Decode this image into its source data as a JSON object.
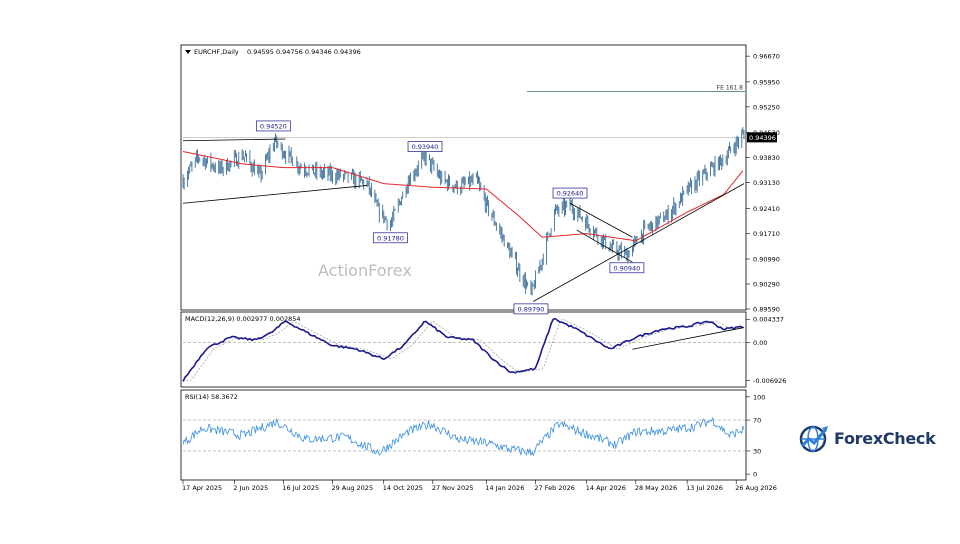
{
  "watermark": "ActionForex",
  "brand": {
    "name": "ForexCheck",
    "icon": "globe-chart-icon",
    "colors": [
      "#1f3a68",
      "#2f7fd8"
    ]
  },
  "chart_data": [
    {
      "type": "candlestick",
      "title": "EURCHF,Daily",
      "ohlc_text": "0.94595 0.94756 0.94346 0.94396",
      "ylim": [
        0.8959,
        0.9687
      ],
      "y_ticks": [
        "0.96670",
        "0.95950",
        "0.95250",
        "0.94530",
        "0.93830",
        "0.93130",
        "0.92410",
        "0.91710",
        "0.90990",
        "0.90290",
        "0.89590"
      ],
      "y_tick_values": [
        0.9667,
        0.9595,
        0.9525,
        0.9453,
        0.9383,
        0.9313,
        0.9241,
        0.9171,
        0.9099,
        0.9029,
        0.8959
      ],
      "current_price": "0.94396",
      "current_price_value": 0.94396,
      "moving_average_color": "#e8262a",
      "price_color": "#3b6e99",
      "level_line": {
        "label": "FE 161.8",
        "value": 0.9568
      },
      "labeled_points": [
        {
          "label": "0.94520",
          "date": "2025-07-07",
          "value": 0.9452
        },
        {
          "label": "0.93940",
          "date": "2025-11-20",
          "value": 0.9394
        },
        {
          "label": "0.91780",
          "date": "2025-10-20",
          "value": 0.9178
        },
        {
          "label": "0.92640",
          "date": "2026-03-30",
          "value": 0.9264
        },
        {
          "label": "0.90940",
          "date": "2026-05-20",
          "value": 0.9094
        },
        {
          "label": "0.89790",
          "date": "2026-02-23",
          "value": 0.8979
        }
      ],
      "path_anchors": [
        [
          "2025-04-17",
          0.932
        ],
        [
          "2025-05-01",
          0.9385
        ],
        [
          "2025-05-20",
          0.935
        ],
        [
          "2025-06-10",
          0.939
        ],
        [
          "2025-06-25",
          0.933
        ],
        [
          "2025-07-08",
          0.943
        ],
        [
          "2025-07-16",
          0.94
        ],
        [
          "2025-07-30",
          0.936
        ],
        [
          "2025-08-15",
          0.934
        ],
        [
          "2025-09-10",
          0.933
        ],
        [
          "2025-09-29",
          0.931
        ],
        [
          "2025-10-08",
          0.924
        ],
        [
          "2025-10-20",
          0.9195
        ],
        [
          "2025-11-05",
          0.932
        ],
        [
          "2025-11-20",
          0.9385
        ],
        [
          "2025-12-05",
          0.932
        ],
        [
          "2025-12-20",
          0.93
        ],
        [
          "2026-01-05",
          0.932
        ],
        [
          "2026-01-14",
          0.925
        ],
        [
          "2026-01-30",
          0.915
        ],
        [
          "2026-02-10",
          0.908
        ],
        [
          "2026-02-23",
          0.9
        ],
        [
          "2026-03-05",
          0.91
        ],
        [
          "2026-03-16",
          0.923
        ],
        [
          "2026-03-30",
          0.925
        ],
        [
          "2026-04-14",
          0.92
        ],
        [
          "2026-05-05",
          0.913
        ],
        [
          "2026-05-20",
          0.911
        ],
        [
          "2026-06-05",
          0.918
        ],
        [
          "2026-06-25",
          0.922
        ],
        [
          "2026-07-13",
          0.929
        ],
        [
          "2026-07-30",
          0.934
        ],
        [
          "2026-08-15",
          0.938
        ],
        [
          "2026-09-02",
          0.945
        ]
      ],
      "ma_anchors": [
        [
          "2025-04-17",
          0.94
        ],
        [
          "2025-06-10",
          0.9365
        ],
        [
          "2025-07-16",
          0.9355
        ],
        [
          "2025-08-29",
          0.9355
        ],
        [
          "2025-10-14",
          0.931
        ],
        [
          "2025-11-27",
          0.93
        ],
        [
          "2026-01-14",
          0.9295
        ],
        [
          "2026-02-12",
          0.922
        ],
        [
          "2026-03-05",
          0.916
        ],
        [
          "2026-04-14",
          0.917
        ],
        [
          "2026-05-28",
          0.915
        ],
        [
          "2026-07-13",
          0.923
        ],
        [
          "2026-08-15",
          0.928
        ],
        [
          "2026-09-02",
          0.935
        ]
      ],
      "x_ticks": [
        "17 Apr 2025",
        "2 Jun 2025",
        "16 Jul 2025",
        "29 Aug 2025",
        "14 Oct 2025",
        "27 Nov 2025",
        "14 Jan 2026",
        "27 Feb 2026",
        "14 Apr 2026",
        "28 May 2026",
        "13 Jul 2026",
        "26 Aug 2026"
      ],
      "x_tick_dates": [
        "2025-04-17",
        "2025-06-02",
        "2025-07-16",
        "2025-08-29",
        "2025-10-14",
        "2025-11-27",
        "2026-01-14",
        "2026-02-27",
        "2026-04-14",
        "2026-05-28",
        "2026-07-13",
        "2026-08-26"
      ],
      "x_range": [
        "2025-04-17",
        "2026-09-02"
      ],
      "trendlines": [
        {
          "from": [
            "2025-04-17",
            0.9255
          ],
          "to": [
            "2025-09-29",
            0.9305
          ]
        },
        {
          "from": [
            "2025-04-17",
            0.943
          ],
          "to": [
            "2025-07-18",
            0.9435
          ]
        },
        {
          "from": [
            "2026-02-25",
            0.898
          ],
          "to": [
            "2026-09-02",
            0.931
          ]
        },
        {
          "from": [
            "2026-03-30",
            0.9255
          ],
          "to": [
            "2026-05-25",
            0.916
          ]
        },
        {
          "from": [
            "2026-04-05",
            0.918
          ],
          "to": [
            "2026-05-25",
            0.909
          ]
        }
      ]
    },
    {
      "type": "line",
      "title": "MACD(12,26,9) 0.002977 0.002854",
      "y_ticks": [
        "0.004337",
        "0.00",
        "-0.006926"
      ],
      "y_tick_values": [
        0.004337,
        0.0,
        -0.006926
      ],
      "ylim": [
        -0.0078,
        0.0053
      ],
      "series": [
        {
          "color": "#1a1a8f",
          "anchors": [
            [
              "2025-04-17",
              -0.007
            ],
            [
              "2025-05-08",
              -0.001
            ],
            [
              "2025-05-30",
              0.001
            ],
            [
              "2025-06-20",
              0.0005
            ],
            [
              "2025-07-05",
              0.0018
            ],
            [
              "2025-07-18",
              0.004
            ],
            [
              "2025-08-05",
              0.002
            ],
            [
              "2025-08-29",
              -0.0005
            ],
            [
              "2025-09-20",
              -0.0012
            ],
            [
              "2025-10-14",
              -0.003
            ],
            [
              "2025-11-01",
              -0.0005
            ],
            [
              "2025-11-20",
              0.004
            ],
            [
              "2025-12-10",
              0.001
            ],
            [
              "2026-01-02",
              0.0005
            ],
            [
              "2026-01-20",
              -0.003
            ],
            [
              "2026-02-05",
              -0.0055
            ],
            [
              "2026-02-27",
              -0.0048
            ],
            [
              "2026-03-15",
              0.0045
            ],
            [
              "2026-04-05",
              0.0025
            ],
            [
              "2026-05-05",
              -0.0012
            ],
            [
              "2026-05-28",
              0.001
            ],
            [
              "2026-06-20",
              0.0025
            ],
            [
              "2026-07-13",
              0.003
            ],
            [
              "2026-08-01",
              0.004
            ],
            [
              "2026-08-15",
              0.0025
            ],
            [
              "2026-09-02",
              0.003
            ]
          ]
        }
      ]
    },
    {
      "type": "line",
      "title": "RSI(14) 58.3672",
      "y_ticks": [
        "100",
        "70",
        "30",
        "0"
      ],
      "y_tick_values": [
        100,
        70,
        30,
        0
      ],
      "ylim": [
        -5,
        105
      ],
      "series": [
        {
          "color": "#3a8fe0",
          "anchors": [
            [
              "2025-04-17",
              40
            ],
            [
              "2025-05-05",
              60
            ],
            [
              "2025-06-10",
              50
            ],
            [
              "2025-07-10",
              68
            ],
            [
              "2025-08-05",
              45
            ],
            [
              "2025-09-10",
              48
            ],
            [
              "2025-10-10",
              28
            ],
            [
              "2025-11-05",
              55
            ],
            [
              "2025-11-25",
              65
            ],
            [
              "2025-12-20",
              45
            ],
            [
              "2026-01-15",
              40
            ],
            [
              "2026-02-05",
              32
            ],
            [
              "2026-02-24",
              28
            ],
            [
              "2026-03-20",
              65
            ],
            [
              "2026-04-14",
              52
            ],
            [
              "2026-05-10",
              38
            ],
            [
              "2026-05-28",
              55
            ],
            [
              "2026-06-25",
              56
            ],
            [
              "2026-07-20",
              62
            ],
            [
              "2026-08-05",
              70
            ],
            [
              "2026-08-20",
              50
            ],
            [
              "2026-09-02",
              58
            ]
          ]
        }
      ]
    }
  ]
}
